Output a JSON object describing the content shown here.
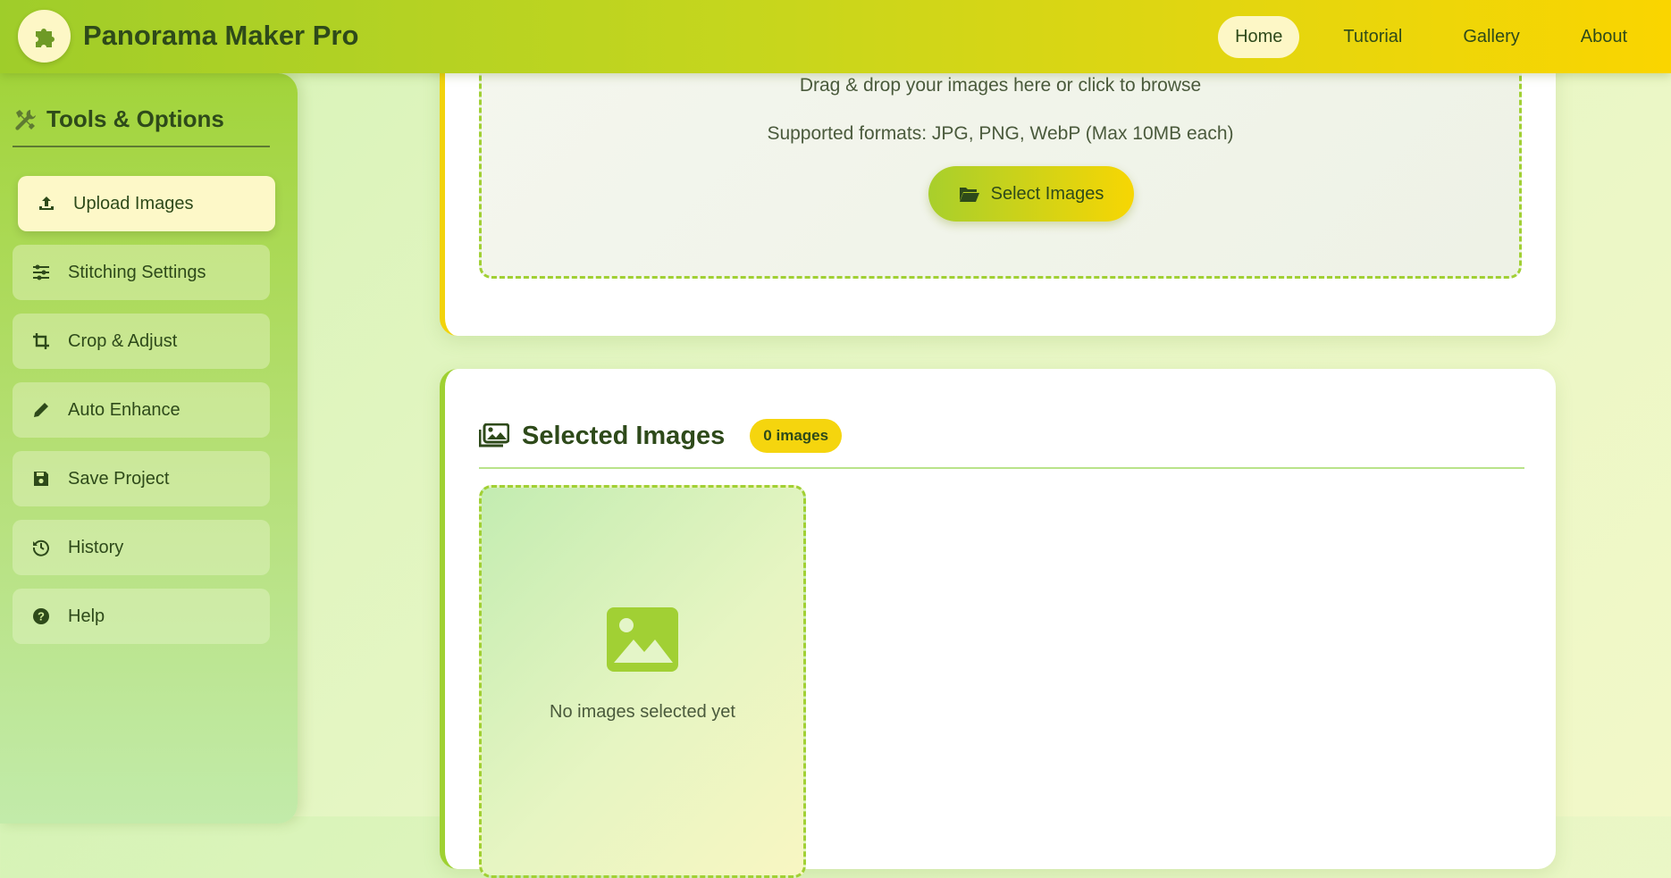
{
  "app": {
    "title": "Panorama Maker Pro",
    "logo_icon": "puzzle-icon"
  },
  "nav": {
    "items": [
      {
        "label": "Home",
        "active": true
      },
      {
        "label": "Tutorial",
        "active": false
      },
      {
        "label": "Gallery",
        "active": false
      },
      {
        "label": "About",
        "active": false
      }
    ]
  },
  "sidebar": {
    "title": "Tools & Options",
    "title_icon": "tools-icon",
    "items": [
      {
        "label": "Upload Images",
        "icon": "upload-icon",
        "active": true
      },
      {
        "label": "Stitching Settings",
        "icon": "sliders-icon",
        "active": false
      },
      {
        "label": "Crop & Adjust",
        "icon": "crop-icon",
        "active": false
      },
      {
        "label": "Auto Enhance",
        "icon": "pencil-icon",
        "active": false
      },
      {
        "label": "Save Project",
        "icon": "save-icon",
        "active": false
      },
      {
        "label": "History",
        "icon": "history-icon",
        "active": false
      },
      {
        "label": "Help",
        "icon": "help-icon",
        "active": false
      }
    ]
  },
  "upload": {
    "drag_text": "Drag & drop your images here or click to browse",
    "formats_text": "Supported formats: JPG, PNG, WebP (Max 10MB each)",
    "button_label": "Select Images",
    "button_icon": "folder-open-icon"
  },
  "selected": {
    "title": "Selected Images",
    "title_icon": "images-icon",
    "count_badge": "0 images",
    "empty_text": "No images selected yet",
    "empty_icon": "image-icon"
  },
  "colors": {
    "accent_green": "#9fcd2a",
    "accent_yellow": "#f7d603",
    "text_dark": "#2e4a1a"
  }
}
